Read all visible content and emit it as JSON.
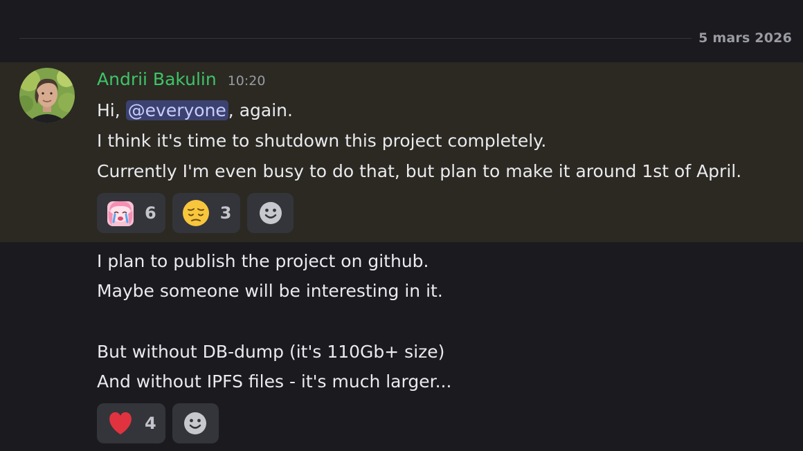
{
  "divider": {
    "date": "5 mars 2026"
  },
  "message1": {
    "author": "Andrii Bakulin",
    "time": "10:20",
    "line1_prefix": "Hi, ",
    "mention": "@everyone",
    "line1_suffix": ", again.",
    "line2": "I think it's time to shutdown this project completely.",
    "line3": "Currently I'm even busy to do that, but plan to make it around 1st of April.",
    "reactions": [
      {
        "emoji": "crying-anime-girl-emoji",
        "count": "6"
      },
      {
        "emoji": "pensive-face-emoji",
        "count": "3"
      }
    ]
  },
  "message2": {
    "line1": "I plan to publish the project on github.",
    "line2": "Maybe someone will be interesting in it.",
    "line3": "But without DB-dump (it's 110Gb+ size)",
    "line4": "And without IPFS files - it's much larger...",
    "reactions": [
      {
        "emoji": "red-heart-emoji",
        "count": "4"
      }
    ]
  },
  "colors": {
    "background": "#1b1b1f",
    "highlight": "#2b2922",
    "author": "#3fc468",
    "mention_bg": "#3c4270",
    "mention_text": "#c9cdfb",
    "reaction_bg": "#34353b"
  }
}
